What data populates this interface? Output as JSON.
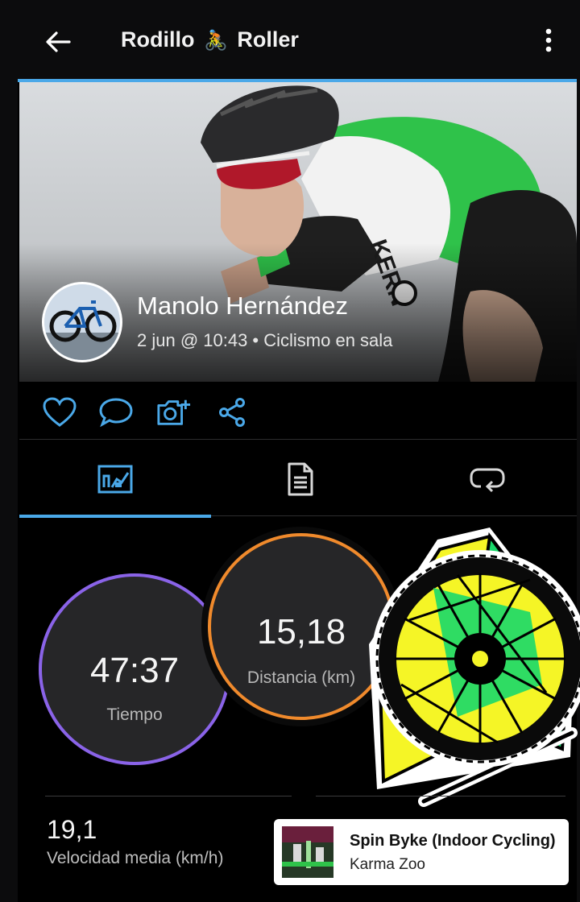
{
  "header": {
    "title_left": "Rodillo",
    "title_emoji": "🚴",
    "title_right": "Roller",
    "back_icon": "arrow-left-icon",
    "menu_icon": "more-vertical-icon"
  },
  "activity": {
    "athlete_name": "Manolo Hernández",
    "meta": "2 jun @ 10:43 • Ciclismo en sala"
  },
  "actions": {
    "icons": [
      "heart-icon",
      "comment-icon",
      "add-photo-icon",
      "share-icon"
    ]
  },
  "tabs": {
    "icons": [
      "stats-tab-icon",
      "details-tab-icon",
      "laps-tab-icon"
    ],
    "selected_index": 0
  },
  "stats": {
    "time_value": "47:37",
    "time_label": "Tiempo",
    "distance_value": "15,18",
    "distance_label": "Distancia (km)",
    "avg_speed_value": "19,1",
    "avg_speed_label": "Velocidad media (km/h)"
  },
  "music": {
    "song": "Spin Byke (Indoor Cycling)",
    "artist": "Karma Zoo"
  },
  "colors": {
    "accent": "#4aa8e8",
    "time_ring": "#8a63e8",
    "distance_ring": "#f08a2c",
    "sticker_yellow": "#f5f526",
    "sticker_green": "#19d96a"
  }
}
